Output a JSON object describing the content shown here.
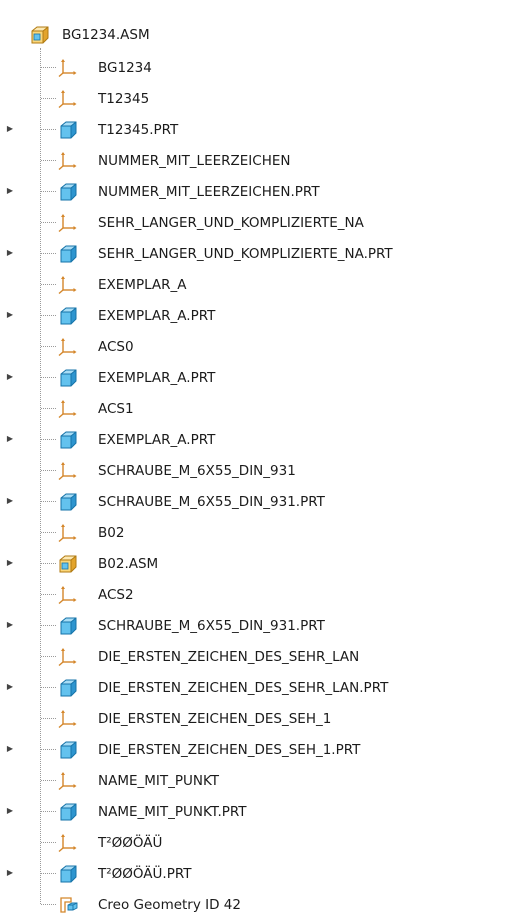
{
  "tree": {
    "root": {
      "label": "BG1234.ASM",
      "icon": "assembly-icon"
    },
    "items": [
      {
        "label": "BG1234",
        "icon": "coordinate-system-icon",
        "expandable": false
      },
      {
        "label": "T12345",
        "icon": "coordinate-system-icon",
        "expandable": false
      },
      {
        "label": "T12345.PRT",
        "icon": "part-icon",
        "expandable": true
      },
      {
        "label": "NUMMER_MIT_LEERZEICHEN",
        "icon": "coordinate-system-icon",
        "expandable": false
      },
      {
        "label": "NUMMER_MIT_LEERZEICHEN.PRT",
        "icon": "part-icon",
        "expandable": true
      },
      {
        "label": "SEHR_LANGER_UND_KOMPLIZIERTE_NA",
        "icon": "coordinate-system-icon",
        "expandable": false
      },
      {
        "label": "SEHR_LANGER_UND_KOMPLIZIERTE_NA.PRT",
        "icon": "part-icon",
        "expandable": true
      },
      {
        "label": "EXEMPLAR_A",
        "icon": "coordinate-system-icon",
        "expandable": false
      },
      {
        "label": "EXEMPLAR_A.PRT",
        "icon": "part-icon",
        "expandable": true
      },
      {
        "label": "ACS0",
        "icon": "coordinate-system-icon",
        "expandable": false
      },
      {
        "label": "EXEMPLAR_A.PRT",
        "icon": "part-icon",
        "expandable": true
      },
      {
        "label": "ACS1",
        "icon": "coordinate-system-icon",
        "expandable": false
      },
      {
        "label": "EXEMPLAR_A.PRT",
        "icon": "part-icon",
        "expandable": true
      },
      {
        "label": "SCHRAUBE_M_6X55_DIN_931",
        "icon": "coordinate-system-icon",
        "expandable": false
      },
      {
        "label": "SCHRAUBE_M_6X55_DIN_931.PRT",
        "icon": "part-icon",
        "expandable": true
      },
      {
        "label": "B02",
        "icon": "coordinate-system-icon",
        "expandable": false
      },
      {
        "label": "B02.ASM",
        "icon": "assembly-icon",
        "expandable": true
      },
      {
        "label": "ACS2",
        "icon": "coordinate-system-icon",
        "expandable": false
      },
      {
        "label": "SCHRAUBE_M_6X55_DIN_931.PRT",
        "icon": "part-icon",
        "expandable": true
      },
      {
        "label": "DIE_ERSTEN_ZEICHEN_DES_SEHR_LAN",
        "icon": "coordinate-system-icon",
        "expandable": false
      },
      {
        "label": "DIE_ERSTEN_ZEICHEN_DES_SEHR_LAN.PRT",
        "icon": "part-icon",
        "expandable": true
      },
      {
        "label": "DIE_ERSTEN_ZEICHEN_DES_SEH_1",
        "icon": "coordinate-system-icon",
        "expandable": false
      },
      {
        "label": "DIE_ERSTEN_ZEICHEN_DES_SEH_1.PRT",
        "icon": "part-icon",
        "expandable": true
      },
      {
        "label": "NAME_MIT_PUNKT",
        "icon": "coordinate-system-icon",
        "expandable": false
      },
      {
        "label": "NAME_MIT_PUNKT.PRT",
        "icon": "part-icon",
        "expandable": true
      },
      {
        "label": "T²ØØÖÄÜ",
        "icon": "coordinate-system-icon",
        "expandable": false
      },
      {
        "label": "T²ØØÖÄÜ.PRT",
        "icon": "part-icon",
        "expandable": true
      },
      {
        "label": "Creo Geometry ID 42",
        "icon": "geometry-feature-icon",
        "expandable": false
      }
    ]
  },
  "colors": {
    "part_blue": "#35a7e0",
    "assembly_yellow": "#f2b73d",
    "csys_orange": "#e5a037"
  }
}
